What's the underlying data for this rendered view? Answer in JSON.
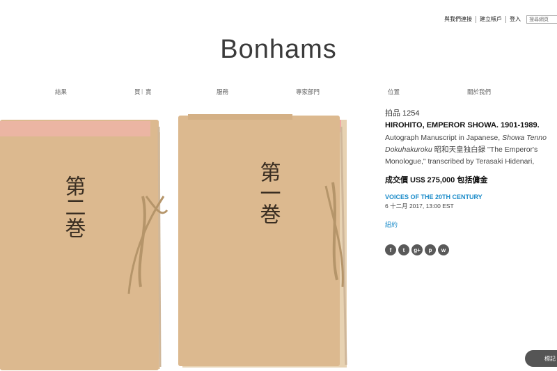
{
  "topbar": {
    "contact": "與我們連接",
    "register": "建立帳戶",
    "login": "登入",
    "search_placeholder": "搜尋網頁"
  },
  "logo": "Bonhams",
  "nav": {
    "results": "結果",
    "buy": "買",
    "sell": "賣",
    "services": "服務",
    "departments": "專家部門",
    "locations": "位置",
    "about": "關於我們"
  },
  "photo": {
    "volume2_label": "第二巻",
    "volume1_label": "第一巻"
  },
  "lot": {
    "number": "拍品 1254",
    "title": "HIROHITO, EMPEROR SHOWA. 1901-1989.",
    "desc_line1_plain": "Autograph Manuscript in Japanese, ",
    "desc_line1_italic": "Showa Tenno",
    "desc_line2_italic": "Dokuhakuroku",
    "desc_line2_plain": " 昭和天皇独白録 \"The Emperor's",
    "desc_line3": "Monologue,\" transcribed by Terasaki Hidenari,",
    "price": "成交價 US$ 275,000 包括傭金",
    "sale_name": "VOICES OF THE 20TH CENTURY",
    "sale_date": "6 十二月 2017, 13:00 EST",
    "location": "紐約"
  },
  "social": [
    "f",
    "t",
    "g+",
    "p",
    "w"
  ],
  "bookmark": "標記",
  "colors": {
    "accent": "#1a8bc9",
    "paper": "#dcb98f",
    "pink_tab": "#f2a8a4",
    "string": "#b5956a"
  }
}
